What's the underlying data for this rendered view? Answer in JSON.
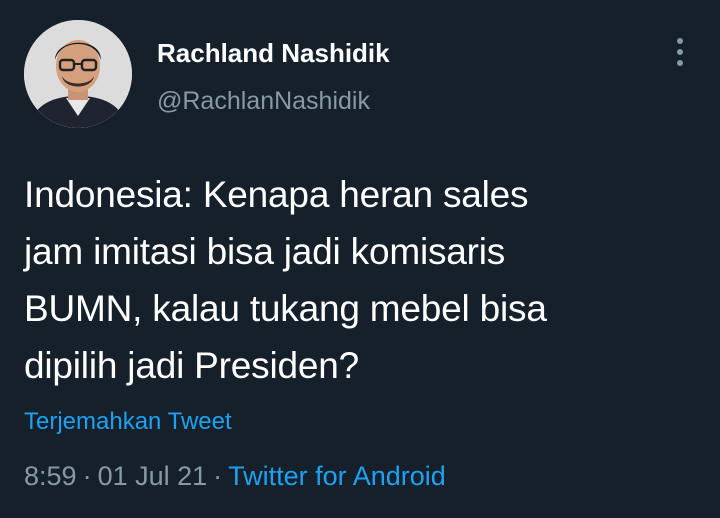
{
  "author": {
    "display_name": "Rachland Nashidik",
    "handle": "@RachlanNashidik"
  },
  "icons": {
    "more": "more-vertical-icon"
  },
  "tweet": {
    "text": "Indonesia: Kenapa heran sales\njam imitasi bisa jadi komisaris\nBUMN, kalau tukang mebel bisa\ndipilih jadi Presiden?",
    "translate_label": "Terjemahkan Tweet",
    "time": "8:59",
    "separator": "·",
    "date": "01 Jul 21",
    "source": "Twitter for Android"
  },
  "colors": {
    "background": "#15202b",
    "text_primary": "#ffffff",
    "text_secondary": "#8899a6",
    "accent": "#1da1f2"
  }
}
